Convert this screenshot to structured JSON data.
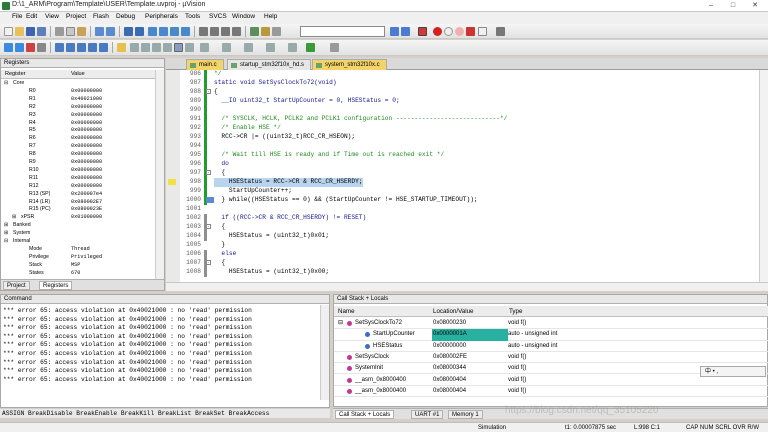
{
  "window": {
    "title": "D:\\1_ARM\\Program\\Template\\USER\\Template.uvproj - µVision"
  },
  "menu": [
    "File",
    "Edit",
    "View",
    "Project",
    "Flash",
    "Debug",
    "Peripherals",
    "Tools",
    "SVCS",
    "Window",
    "Help"
  ],
  "toolbar": {
    "target": ""
  },
  "registers_panel": {
    "title": "Registers",
    "col_register": "Register",
    "col_value": "Value",
    "rows": [
      {
        "name": "Core",
        "value": "",
        "indent": 1,
        "exp": "-"
      },
      {
        "name": "R0",
        "value": "0x00000000",
        "indent": 3
      },
      {
        "name": "R1",
        "value": "0x40021000",
        "indent": 3
      },
      {
        "name": "R2",
        "value": "0x00000000",
        "indent": 3
      },
      {
        "name": "R3",
        "value": "0x00000000",
        "indent": 3
      },
      {
        "name": "R4",
        "value": "0x00000000",
        "indent": 3
      },
      {
        "name": "R5",
        "value": "0x00000000",
        "indent": 3
      },
      {
        "name": "R6",
        "value": "0x00000000",
        "indent": 3
      },
      {
        "name": "R7",
        "value": "0x00000000",
        "indent": 3
      },
      {
        "name": "R8",
        "value": "0x00000000",
        "indent": 3
      },
      {
        "name": "R9",
        "value": "0x00000000",
        "indent": 3
      },
      {
        "name": "R10",
        "value": "0x00000000",
        "indent": 3
      },
      {
        "name": "R11",
        "value": "0x00000000",
        "indent": 3
      },
      {
        "name": "R12",
        "value": "0x00000000",
        "indent": 3
      },
      {
        "name": "R13 (SP)",
        "value": "0x200007e4",
        "indent": 3
      },
      {
        "name": "R14 (LR)",
        "value": "0x080002E7",
        "indent": 3
      },
      {
        "name": "R15 (PC)",
        "value": "0x0800023E",
        "indent": 3
      },
      {
        "name": "xPSR",
        "value": "0x01000000",
        "indent": 2,
        "exp": "+"
      },
      {
        "name": "Banked",
        "value": "",
        "indent": 1,
        "exp": "+"
      },
      {
        "name": "System",
        "value": "",
        "indent": 1,
        "exp": "+"
      },
      {
        "name": "Internal",
        "value": "",
        "indent": 1,
        "exp": "-"
      },
      {
        "name": "Mode",
        "value": "Thread",
        "indent": 3
      },
      {
        "name": "Privilege",
        "value": "Privileged",
        "indent": 3
      },
      {
        "name": "Stack",
        "value": "MSP",
        "indent": 3
      },
      {
        "name": "States",
        "value": "670",
        "indent": 3
      }
    ],
    "tabs": [
      "Project",
      "Registers"
    ]
  },
  "editor": {
    "tabs": [
      "main.c",
      "startup_stm32f10x_hd.s",
      "system_stm32f10x.c"
    ],
    "lines": [
      {
        "n": "986",
        "t": "*/",
        "g": "green"
      },
      {
        "n": "987",
        "t": "static void SetSysClockTo72(void)",
        "g": "green"
      },
      {
        "n": "988",
        "t": "{",
        "g": "green",
        "fold": "-"
      },
      {
        "n": "989",
        "t": "  __IO uint32_t StartUpCounter = 0, HSEStatus = 0;",
        "g": "green"
      },
      {
        "n": "990",
        "t": "",
        "g": "green"
      },
      {
        "n": "991",
        "t": "  /* SYSCLK, HCLK, PCLK2 and PCLK1 configuration ----------------------------*/",
        "g": "green"
      },
      {
        "n": "992",
        "t": "  /* Enable HSE */",
        "g": "green"
      },
      {
        "n": "993",
        "t": "  RCC->CR |= ((uint32_t)RCC_CR_HSEON);",
        "g": "green"
      },
      {
        "n": "994",
        "t": "",
        "g": "green"
      },
      {
        "n": "995",
        "t": "  /* Wait till HSE is ready and if Time out is reached exit */",
        "g": "green"
      },
      {
        "n": "996",
        "t": "  do",
        "g": "green"
      },
      {
        "n": "997",
        "t": "  {",
        "g": "green",
        "fold": "-"
      },
      {
        "n": "998",
        "t": "    HSEStatus = RCC->CR & RCC_CR_HSERDY;",
        "g": "green",
        "hl": true,
        "arrow": true
      },
      {
        "n": "999",
        "t": "    StartUpCounter++;",
        "g": "green"
      },
      {
        "n": "1000",
        "t": "  } while((HSEStatus == 0) && (StartUpCounter != HSE_STARTUP_TIMEOUT));",
        "g": "green",
        "cursor": true
      },
      {
        "n": "1001",
        "t": "",
        "g": ""
      },
      {
        "n": "1002",
        "t": "  if ((RCC->CR & RCC_CR_HSERDY) != RESET)",
        "g": "gray"
      },
      {
        "n": "1003",
        "t": "  {",
        "g": "gray",
        "fold": "-"
      },
      {
        "n": "1004",
        "t": "    HSEStatus = (uint32_t)0x01;",
        "g": "gray"
      },
      {
        "n": "1005",
        "t": "  }",
        "g": ""
      },
      {
        "n": "1006",
        "t": "  else",
        "g": "gray"
      },
      {
        "n": "1007",
        "t": "  {",
        "g": "gray",
        "fold": "-"
      },
      {
        "n": "1008",
        "t": "    HSEStatus = (uint32_t)0x00;",
        "g": "gray"
      }
    ]
  },
  "command": {
    "title": "Command",
    "lines": [
      "*** error 65: access violation at 0x40021000 : no 'read' permission",
      "*** error 65: access violation at 0x40021000 : no 'read' permission",
      "*** error 65: access violation at 0x40021000 : no 'read' permission",
      "*** error 65: access violation at 0x40021000 : no 'read' permission",
      "*** error 65: access violation at 0x40021000 : no 'read' permission",
      "*** error 65: access violation at 0x40021000 : no 'read' permission",
      "*** error 65: access violation at 0x40021000 : no 'read' permission",
      "*** error 65: access violation at 0x40021000 : no 'read' permission",
      "*** error 65: access violation at 0x40021000 : no 'read' permission"
    ],
    "hint": "ASSIGN BreakDisable BreakEnable BreakKill BreakList BreakSet BreakAccess"
  },
  "callstack": {
    "title": "Call Stack + Locals",
    "col_name": "Name",
    "col_location": "Location/Value",
    "col_type": "Type",
    "rows": [
      {
        "name": "SetSysClockTo72",
        "loc": "0x08000230",
        "type": "void f()",
        "indent": 0,
        "exp": "-",
        "ico": "#c23a8f"
      },
      {
        "name": "StartUpCounter",
        "loc": "0x0000001A",
        "type": "auto - unsigned int",
        "indent": 2,
        "ico": "#3a6fc2",
        "sel": true
      },
      {
        "name": "HSEStatus",
        "loc": "0x00000000",
        "type": "auto - unsigned int",
        "indent": 2,
        "ico": "#3a6fc2"
      },
      {
        "name": "SetSysClock",
        "loc": "0x080002FE",
        "type": "void f()",
        "indent": 0,
        "ico": "#c23a8f"
      },
      {
        "name": "SystemInit",
        "loc": "0x08000344",
        "type": "void f()",
        "indent": 0,
        "ico": "#c23a8f"
      },
      {
        "name": "__asm_0x8000400",
        "loc": "0x08000404",
        "type": "void f()",
        "indent": 0,
        "ico": "#c23a8f"
      },
      {
        "name": "__asm_0x8000400",
        "loc": "0x08000404",
        "type": "void f()",
        "indent": 0,
        "ico": "#c23a8f"
      }
    ],
    "tabs": [
      "Call Stack + Locals",
      "UART #1",
      "Memory 1"
    ]
  },
  "ime": "中 • ,",
  "watermark": "https://blog.csdn.net/qq_35105220",
  "status": {
    "mode": "Simulation",
    "time": "t1: 0.00007875 sec",
    "pos": "L:998 C:1",
    "keys": "CAP  NUM  SCRL  OVR  R/W"
  }
}
